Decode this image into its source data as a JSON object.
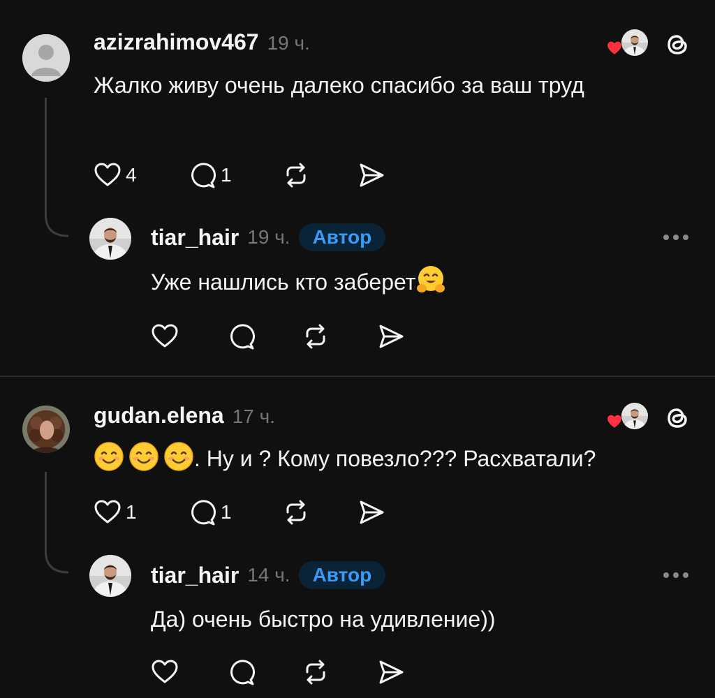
{
  "threads": [
    {
      "comment": {
        "username": "azizrahimov467",
        "time": "19 ч.",
        "text": "Жалко живу очень далеко спасибо за ваш труд",
        "likes": "4",
        "replies": "1"
      },
      "reply": {
        "username": "tiar_hair",
        "time": "19 ч.",
        "badge": "Автор",
        "text": "Уже нашлись кто заберет",
        "emoji": "hugging-face"
      }
    },
    {
      "comment": {
        "username": "gudan.elena",
        "time": "17 ч.",
        "emojis": [
          "smiling-face",
          "smiling-face",
          "smiling-face"
        ],
        "text": ". Ну и ? Кому повезло??? Расхватали?",
        "likes": "1",
        "replies": "1"
      },
      "reply": {
        "username": "tiar_hair",
        "time": "14 ч.",
        "badge": "Автор",
        "text": "Да) очень быстро на удивление))"
      }
    }
  ],
  "icons": [
    "heart-icon",
    "comment-icon",
    "repost-icon",
    "share-icon",
    "threads-logo-icon",
    "more-icon",
    "liked-by-author-icon"
  ],
  "colors": {
    "background": "#101010",
    "badge_text": "#3a9bf7",
    "badge_bg": "#0b2337",
    "like_red": "#ff3040",
    "muted": "#777777"
  }
}
